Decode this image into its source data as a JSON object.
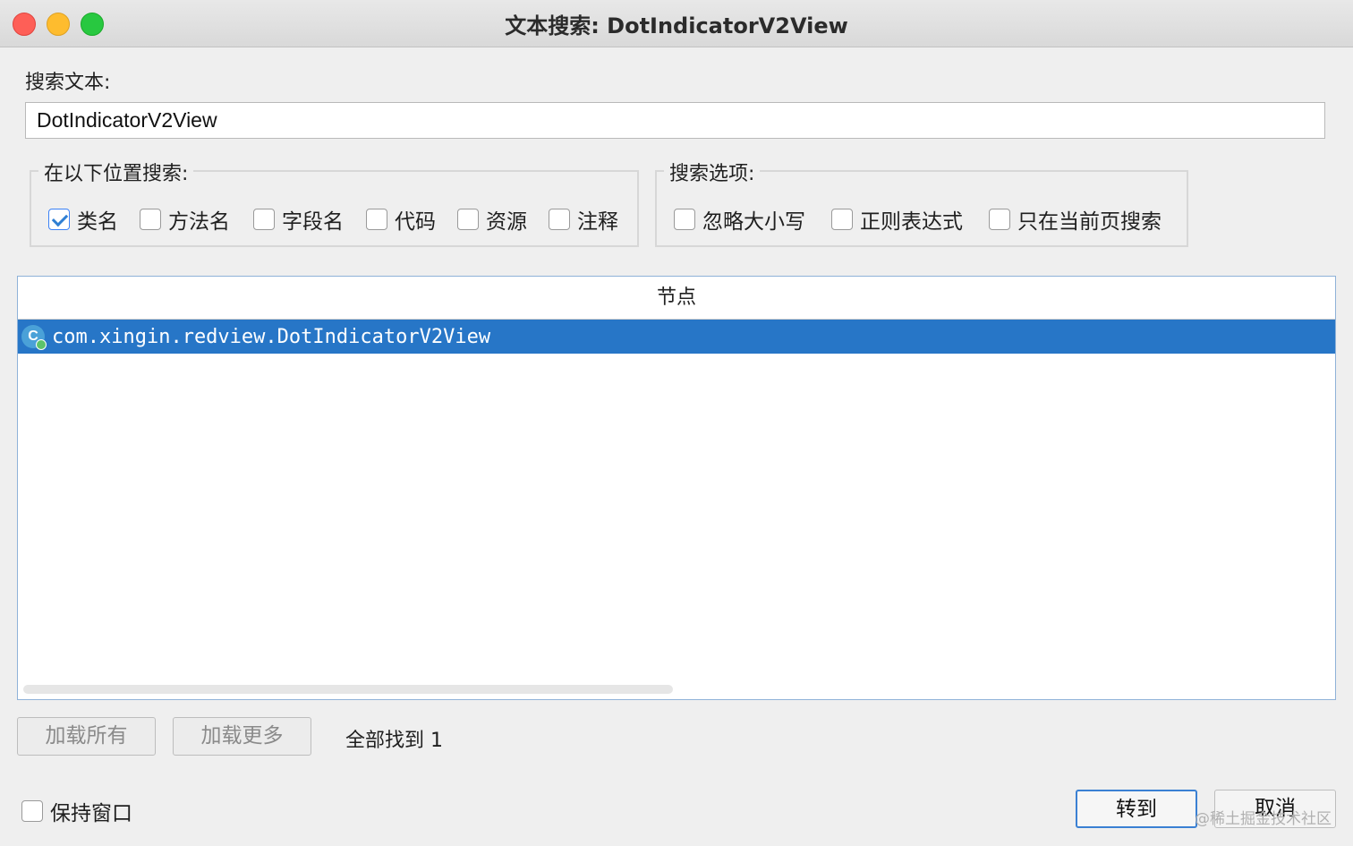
{
  "window": {
    "title": "文本搜索: DotIndicatorV2View"
  },
  "search": {
    "label": "搜索文本:",
    "value": "DotIndicatorV2View"
  },
  "scope": {
    "title": "在以下位置搜索:",
    "options": [
      {
        "label": "类名",
        "checked": true
      },
      {
        "label": "方法名",
        "checked": false
      },
      {
        "label": "字段名",
        "checked": false
      },
      {
        "label": "代码",
        "checked": false
      },
      {
        "label": "资源",
        "checked": false
      },
      {
        "label": "注释",
        "checked": false
      }
    ]
  },
  "options": {
    "title": "搜索选项:",
    "items": [
      {
        "label": "忽略大小写",
        "checked": false
      },
      {
        "label": "正则表达式",
        "checked": false
      },
      {
        "label": "只在当前页搜索",
        "checked": false
      }
    ]
  },
  "results": {
    "header": "节点",
    "rows": [
      {
        "icon": "class-icon",
        "text": "com.xingin.redview.DotIndicatorV2View",
        "selected": true
      }
    ]
  },
  "footer": {
    "load_all": "加载所有",
    "load_more": "加载更多",
    "found_text": "全部找到 1",
    "keep_window": "保持窗口",
    "goto": "转到",
    "cancel": "取消",
    "watermark": "@稀土掘金技术社区"
  }
}
